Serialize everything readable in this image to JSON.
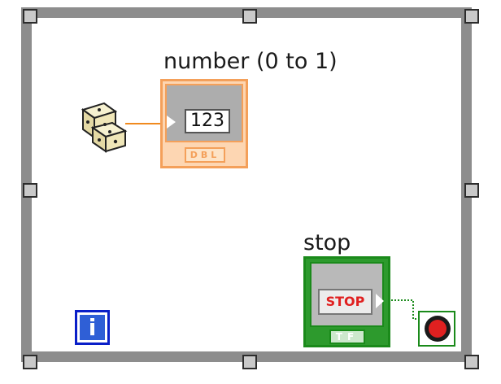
{
  "diagram": {
    "numeric_indicator": {
      "label": "number (0 to 1)",
      "display_text": "123",
      "data_type": "DBL"
    },
    "stop_control": {
      "label": "stop",
      "button_text": "STOP",
      "data_type": "TF"
    },
    "iteration_terminal": {
      "glyph": "i"
    },
    "icons": {
      "random_number_node": "dice-icon",
      "stop_condition_terminal": "stop-sign-icon"
    },
    "colors": {
      "loop_frame": "#8d8d8d",
      "numeric_orange": "#f4a05a",
      "boolean_green": "#1a8a1a",
      "wire_orange": "#f08a1e",
      "stop_red": "#e02020",
      "iteration_blue": "#0a1fc8"
    }
  }
}
